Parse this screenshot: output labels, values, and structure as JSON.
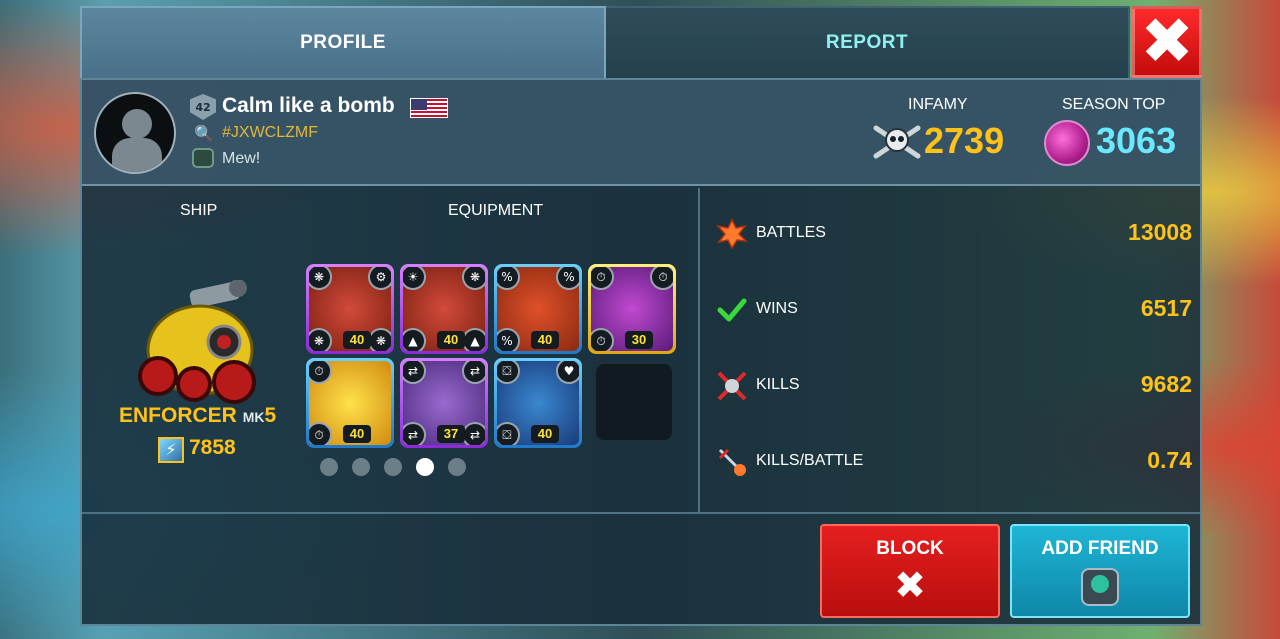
{
  "tabs": {
    "profile": "PROFILE",
    "report": "REPORT"
  },
  "close_symbol": "✖",
  "player": {
    "level": "42",
    "name": "Calm like a bomb",
    "tag": "#JXWCLZMF",
    "status": "Mew!",
    "flag": "us-flag-icon"
  },
  "infamy": {
    "label": "INFAMY",
    "value": "2739"
  },
  "season_top": {
    "label": "SEASON TOP",
    "value": "3063"
  },
  "ship": {
    "label": "SHIP",
    "name": "ENFORCER",
    "mk_label": "MK",
    "mk_number": "5",
    "power": "7858"
  },
  "equipment": {
    "label": "EQUIPMENT",
    "cards": [
      {
        "level": "40",
        "rank": "IV",
        "rarity": "epic"
      },
      {
        "level": "40",
        "rank": "IV",
        "rarity": "epic"
      },
      {
        "level": "40",
        "rank": "IV",
        "rarity": "rare"
      },
      {
        "level": "30",
        "rank": "III",
        "rarity": "legendary"
      },
      {
        "level": "40",
        "rank": "IV",
        "rarity": "rare"
      },
      {
        "level": "37",
        "rank": "IV",
        "rarity": "epic"
      },
      {
        "level": "40",
        "rank": "IV",
        "rarity": "rare"
      }
    ],
    "pages": 5,
    "active_page": 4
  },
  "stats": {
    "battles": {
      "label": "BATTLES",
      "value": "13008"
    },
    "wins": {
      "label": "WINS",
      "value": "6517"
    },
    "kills": {
      "label": "KILLS",
      "value": "9682"
    },
    "kills_per_battle": {
      "label": "KILLS/BATTLE",
      "value": "0.74"
    }
  },
  "buttons": {
    "block": "BLOCK",
    "add_friend": "ADD FRIEND"
  },
  "colors": {
    "gold": "#ffc21a",
    "cyan": "#6ae8ff",
    "block_red": "#e51f1f",
    "friend_teal": "#1eb6d6"
  }
}
